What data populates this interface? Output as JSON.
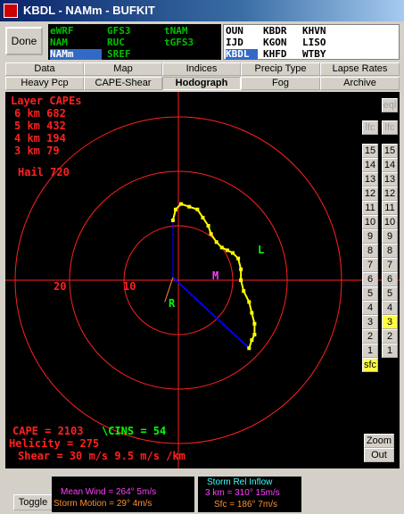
{
  "window": {
    "title": "KBDL - NAMm - BUFKIT"
  },
  "done_label": "Done",
  "models": {
    "col1": [
      "eWRF",
      "NAM",
      "NAMm"
    ],
    "col2": [
      "GFS3",
      "RUC",
      "SREF"
    ],
    "col3": [
      "tNAM",
      "tGFS3"
    ],
    "selected": "NAMm"
  },
  "stations": {
    "col1": [
      "OUN",
      "IJD",
      "KBDL"
    ],
    "col2": [
      "KBDR",
      "KGON",
      "KHFD"
    ],
    "col3": [
      "KHVN",
      "LISO",
      "WTBY"
    ],
    "selected": "KBDL"
  },
  "tabs": {
    "row1": [
      "Data",
      "Map",
      "Indices",
      "Precip Type",
      "Lapse Rates"
    ],
    "row2": [
      "Heavy Pcp",
      "CAPE-Shear",
      "Hodograph",
      "Fog",
      "Archive"
    ],
    "active": "Hodograph"
  },
  "layer_cape": {
    "title": "Layer CAPEs",
    "rows": [
      "6 km  682",
      "5 km  432",
      "4 km  194",
      "3 km  79"
    ]
  },
  "hail": "Hail  720",
  "ring_labels": {
    "r20": "20",
    "r10": "10"
  },
  "markers": {
    "L": "L",
    "M": "M",
    "R": "R"
  },
  "buttons": {
    "eql": "eql",
    "lfc1": "lfc",
    "lfc2": "lfc",
    "left_col": [
      "15",
      "14",
      "13",
      "12",
      "11",
      "10",
      "9",
      "8",
      "7",
      "6",
      "5",
      "4",
      "3",
      "2",
      "1",
      "sfc"
    ],
    "right_col": [
      "15",
      "14",
      "13",
      "12",
      "11",
      "10",
      "9",
      "8",
      "7",
      "6",
      "5",
      "4",
      "3",
      "2",
      "1"
    ],
    "zoom": "Zoom",
    "out": "Out",
    "toggle": "Toggle"
  },
  "indices": {
    "cape": "CAPE =  2103",
    "cins": "\\CINS =  54",
    "helicity": "Helicity =  275",
    "shear": "Shear =  30 m/s    9.5 m/s /km"
  },
  "mean_wind": {
    "mean": "Mean Wind = 264°  5m/s",
    "storm": "Storm Motion = 29°  4m/s"
  },
  "inflow": {
    "title": "Storm Rel Inflow",
    "km3": "3 km = 310°  15m/s",
    "sfc": "Sfc = 186°  7m/s"
  },
  "hodograph": {
    "center_kt": [
      0,
      0
    ],
    "scale_kt_per_ring": 10,
    "points_kt": [
      [
        -1,
        11
      ],
      [
        -0.5,
        13
      ],
      [
        0.5,
        14
      ],
      [
        2,
        13.5
      ],
      [
        3.5,
        13
      ],
      [
        4.5,
        11.5
      ],
      [
        5.5,
        10
      ],
      [
        6,
        8.5
      ],
      [
        7,
        7
      ],
      [
        8,
        6
      ],
      [
        9,
        5.5
      ],
      [
        10,
        5
      ],
      [
        11,
        4
      ],
      [
        11.5,
        2
      ],
      [
        11.5,
        0
      ],
      [
        12,
        -2
      ],
      [
        13,
        -4
      ],
      [
        13.5,
        -6
      ],
      [
        14,
        -8
      ],
      [
        14,
        -10
      ],
      [
        13.5,
        -11
      ],
      [
        13,
        -12.5
      ]
    ],
    "storm_vector_end_kt": [
      13,
      -12.5
    ],
    "orange_start_kt": [
      -1,
      0.5
    ],
    "orange_end_kt": [
      -2.5,
      -4
    ],
    "colors": {
      "trace": "#ffff00",
      "rings": "#ff2020",
      "blue": "#0000ff",
      "orange": "#ff9030"
    }
  }
}
